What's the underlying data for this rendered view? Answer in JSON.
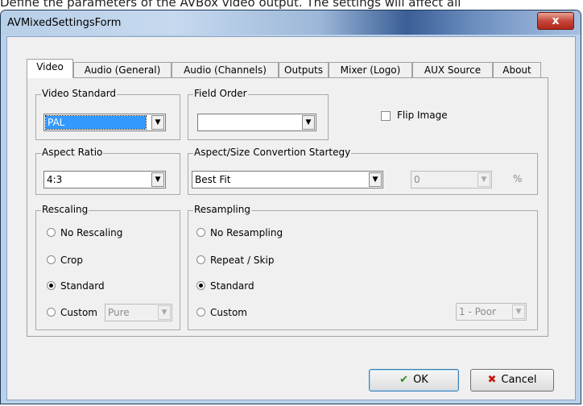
{
  "background": {
    "caption": "Define the parameters of the AVBox video output. The settings will affect all"
  },
  "window": {
    "title": "AVMixedSettingsForm",
    "close_glyph": "x"
  },
  "tabs": [
    "Video",
    "Audio (General)",
    "Audio (Channels)",
    "Outputs",
    "Mixer (Logo)",
    "AUX Source",
    "About"
  ],
  "video_standard": {
    "label": "Video Standard",
    "value": "PAL"
  },
  "field_order": {
    "label": "Field Order",
    "value": ""
  },
  "flip_image": {
    "label": "Flip Image",
    "checked": false
  },
  "aspect_ratio": {
    "label": "Aspect Ratio",
    "value": "4:3"
  },
  "aspect_strategy": {
    "label": "Aspect/Size Convertion Startegy",
    "value": "Best Fit",
    "amount": "0",
    "unit": "%"
  },
  "rescaling": {
    "label": "Rescaling",
    "options": [
      "No Rescaling",
      "Crop",
      "Standard",
      "Custom"
    ],
    "selected": "Standard",
    "custom_value": "Pure"
  },
  "resampling": {
    "label": "Resampling",
    "options": [
      "No Resampling",
      "Repeat / Skip",
      "Standard",
      "Custom"
    ],
    "selected": "Standard",
    "custom_value": "1 - Poor"
  },
  "buttons": {
    "ok": "OK",
    "cancel": "Cancel"
  },
  "colors": {
    "accent": "#3399ff",
    "ok_icon": "#2e8b1e",
    "cancel_icon": "#c21a0e",
    "close": "#c4473a"
  },
  "icons": {
    "ok": "checkmark-icon",
    "cancel": "x-icon",
    "close": "close-icon",
    "dropdown": "chevron-down-icon"
  }
}
